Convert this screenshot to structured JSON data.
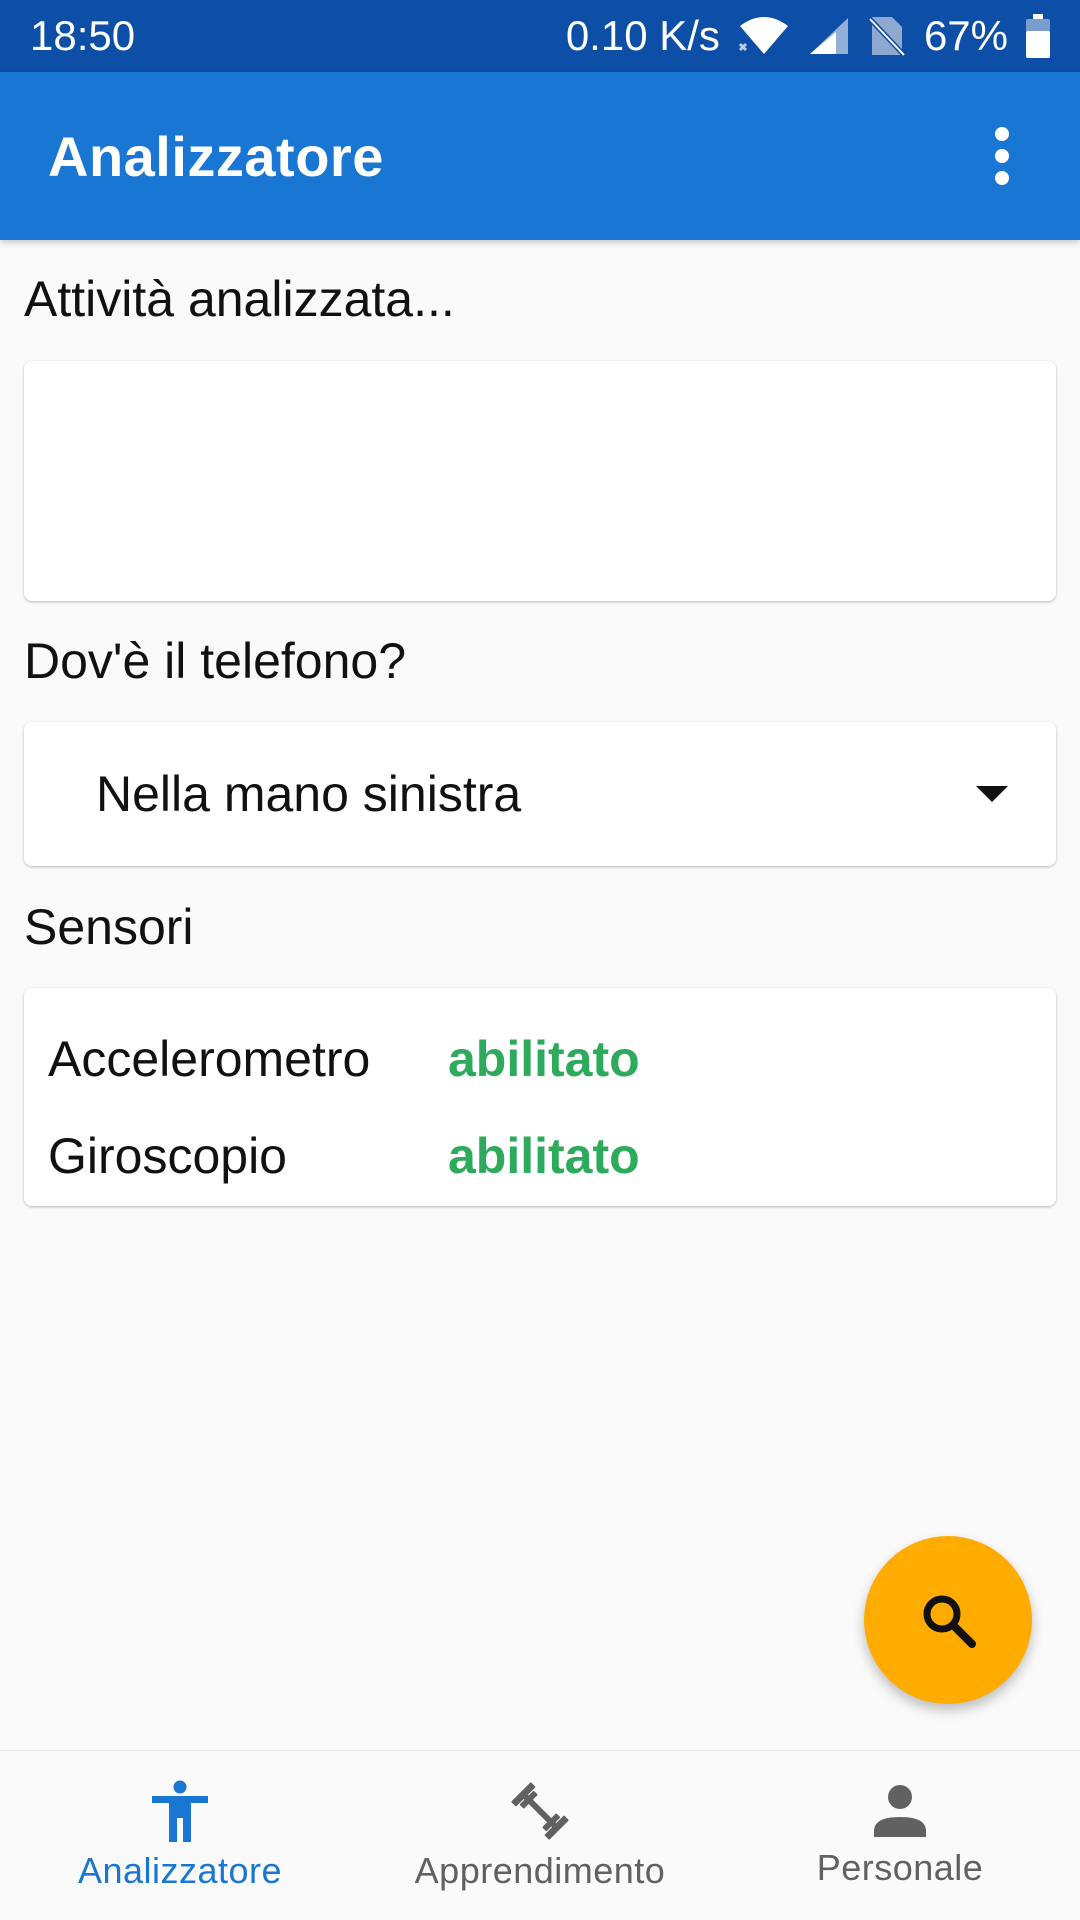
{
  "status_bar": {
    "time": "18:50",
    "network_speed": "0.10 K/s",
    "battery": "67%",
    "icons": [
      "wifi-icon",
      "signal-icon",
      "no-sim-icon",
      "battery-icon"
    ]
  },
  "app_bar": {
    "title": "Analizzatore",
    "overflow_icon": "more-vert-icon"
  },
  "activity": {
    "label": "Attività analizzata...",
    "value": ""
  },
  "phone_position": {
    "label": "Dov'è il telefono?",
    "selected": "Nella mano sinistra"
  },
  "sensors": {
    "label": "Sensori",
    "items": [
      {
        "name": "Accelerometro",
        "status": "abilitato"
      },
      {
        "name": "Giroscopio",
        "status": "abilitato"
      }
    ]
  },
  "fab": {
    "icon": "search-icon"
  },
  "bottom_nav": {
    "items": [
      {
        "label": "Analizzatore",
        "icon": "accessibility-icon",
        "active": true
      },
      {
        "label": "Apprendimento",
        "icon": "dumbbell-icon",
        "active": false
      },
      {
        "label": "Personale",
        "icon": "person-icon",
        "active": false
      }
    ]
  },
  "colors": {
    "status_bar": "#0d4ea6",
    "app_bar": "#1976d2",
    "enabled_status": "#2eaa5c",
    "fab": "#ffab00",
    "nav_active": "#1976d2",
    "nav_inactive": "#616161"
  }
}
